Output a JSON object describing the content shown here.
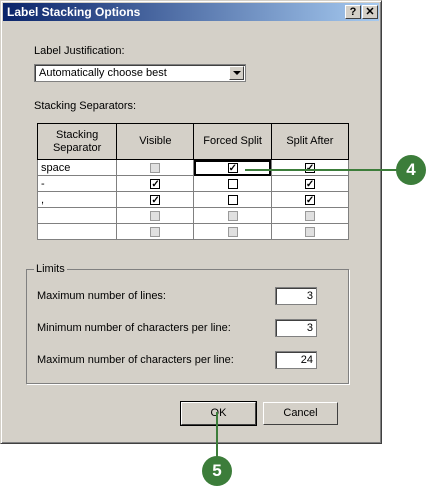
{
  "window": {
    "title": "Label Stacking Options",
    "help_btn": "?",
    "close_btn": "✕"
  },
  "justification": {
    "label": "Label Justification:",
    "value": "Automatically choose best"
  },
  "separators": {
    "label": "Stacking Separators:",
    "headers": [
      "Stacking Separator",
      "Visible",
      "Forced Split",
      "Split After"
    ],
    "rows": [
      {
        "sep": "space",
        "visible": "disabled",
        "forced": "checked",
        "after": "checked"
      },
      {
        "sep": "-",
        "visible": "checked",
        "forced": "unchecked",
        "after": "checked"
      },
      {
        "sep": ",",
        "visible": "checked",
        "forced": "unchecked",
        "after": "checked"
      },
      {
        "sep": "",
        "visible": "disabled",
        "forced": "disabled",
        "after": "disabled"
      },
      {
        "sep": "",
        "visible": "disabled",
        "forced": "disabled",
        "after": "disabled"
      }
    ]
  },
  "limits": {
    "title": "Limits",
    "max_lines_label": "Maximum number of lines:",
    "max_lines": "3",
    "min_chars_label": "Minimum number of characters per line:",
    "min_chars": "3",
    "max_chars_label": "Maximum number of characters per line:",
    "max_chars": "24"
  },
  "buttons": {
    "ok": "OK",
    "cancel": "Cancel"
  },
  "callouts": {
    "four": "4",
    "five": "5"
  },
  "colors": {
    "callout": "#3c7d3a",
    "titlebar": "#0a246a"
  }
}
